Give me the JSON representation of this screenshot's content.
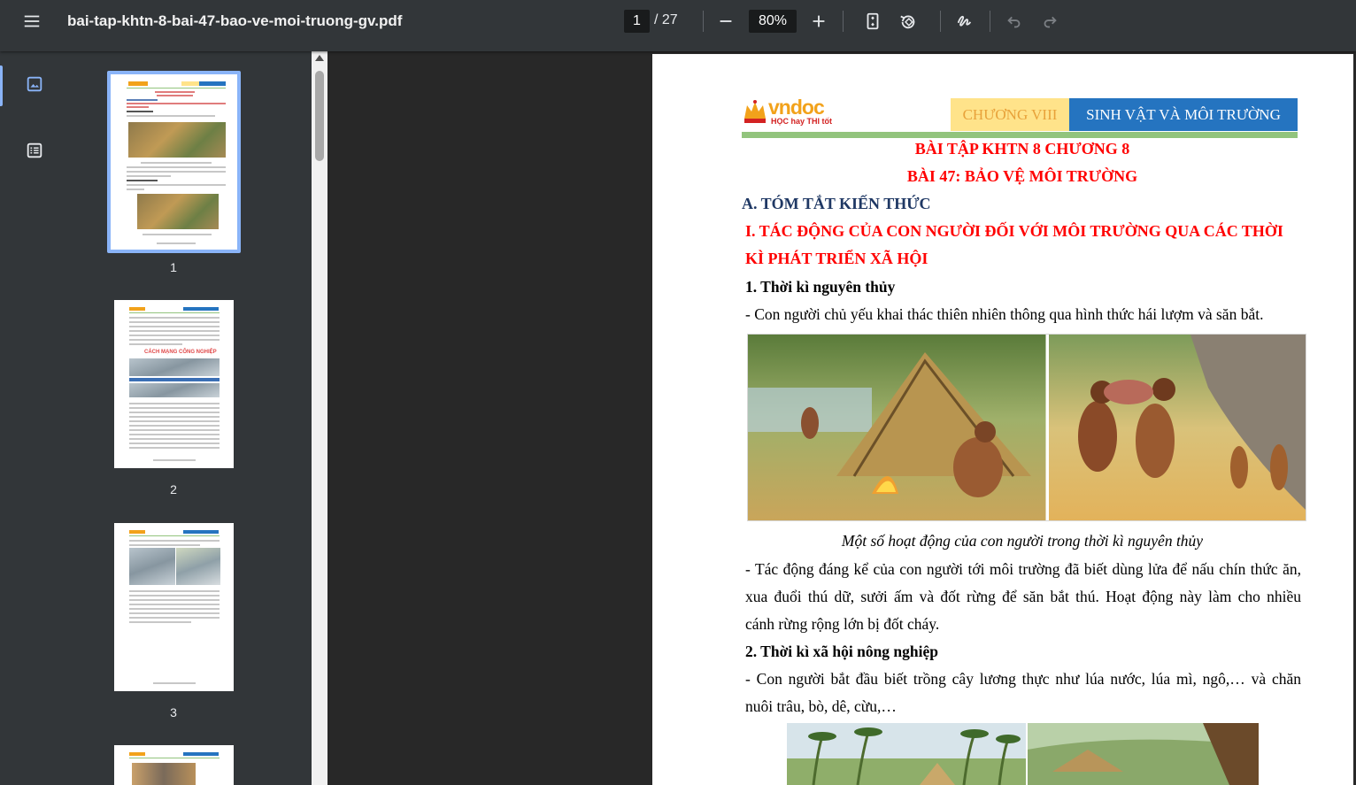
{
  "toolbar": {
    "file_name": "bai-tap-khtn-8-bai-47-bao-ve-moi-truong-gv.pdf",
    "current_page": "1",
    "total_pages": "/ 27",
    "zoom": "80%"
  },
  "sidebar": {
    "thumbnails": [
      {
        "page": "1"
      },
      {
        "page": "2"
      },
      {
        "page": "3"
      }
    ],
    "thumb2_heading": "CÁCH MẠNG CÔNG NGHIỆP"
  },
  "doc": {
    "logo_text": "vndoc",
    "logo_slogan": "HỌC hay THI tốt",
    "chapter_label": "CHƯƠNG VIII",
    "chapter_title": "SINH VẬT VÀ MÔI TRƯỜNG",
    "title_1": "BÀI TẬP KHTN 8 CHƯƠNG 8",
    "title_2": "BÀI 47: BẢO VỆ MÔI TRƯỜNG",
    "section_a": "A. TÓM TẮT KIẾN THỨC",
    "section_i_line1": "I. TÁC ĐỘNG CỦA CON NGƯỜI ĐỐI VỚI MÔI TRƯỜNG QUA CÁC THỜI",
    "section_i_line2": "KÌ PHÁT TRIỂN XÃ HỘI",
    "sub_1": "1. Thời kì nguyên thủy",
    "p1": "- Con người chủ yếu khai thác thiên nhiên thông qua hình thức hái lượm và săn bắt.",
    "caption_1": "Một số hoạt động của con người trong thời kì nguyên thủy",
    "p2_line1": "- Tác động đáng kể của con người tới môi trường đã biết dùng lửa để nấu chín thức ăn,",
    "p2_line2": "xua đuổi thú dữ, sưởi ấm và đốt rừng để săn bắt thú. Hoạt động này làm cho nhiều",
    "p2_line3": "cánh rừng rộng lớn bị đốt cháy.",
    "sub_2": "2. Thời kì xã hội nông nghiệp",
    "p3_line1": "- Con người bắt đầu biết trồng cây lương thực như lúa nước, lúa mì, ngô,… và chăn",
    "p3_line2": "nuôi trâu, bò, dê, cừu,…"
  }
}
